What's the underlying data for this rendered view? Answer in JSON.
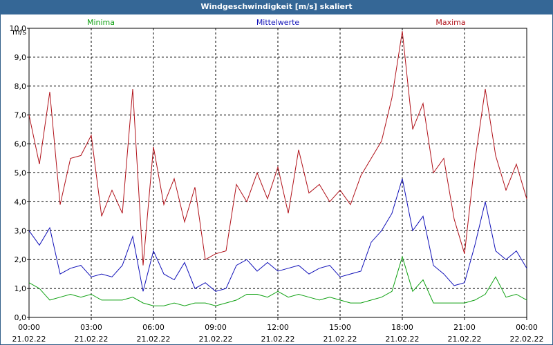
{
  "window": {
    "title": "Windgeschwindigkeit [m/s] skaliert"
  },
  "colors": {
    "minima": "#0da010",
    "mean": "#1010b8",
    "maxima": "#b01018",
    "titlebar": "#356796"
  },
  "chart_data": {
    "type": "line",
    "ylabel": "m/s",
    "ylim": [
      0,
      10
    ],
    "yticks": [
      "0,0",
      "1,0",
      "2,0",
      "3,0",
      "4,0",
      "5,0",
      "6,0",
      "7,0",
      "8,0",
      "9,0",
      "10,0"
    ],
    "xlim_hours": [
      0,
      24
    ],
    "xticks": [
      {
        "time": "00:00",
        "date": "21.02.22"
      },
      {
        "time": "03:00",
        "date": "21.02.22"
      },
      {
        "time": "06:00",
        "date": "21.02.22"
      },
      {
        "time": "09:00",
        "date": "21.02.22"
      },
      {
        "time": "12:00",
        "date": "21.02.22"
      },
      {
        "time": "15:00",
        "date": "21.02.22"
      },
      {
        "time": "18:00",
        "date": "21.02.22"
      },
      {
        "time": "21:00",
        "date": "21.02.22"
      },
      {
        "time": "00:00",
        "date": "22.02.22"
      }
    ],
    "grid": true,
    "legend": [
      "Minima",
      "Mittelwerte",
      "Maxima"
    ],
    "series": [
      {
        "name": "Minima",
        "x": [
          0,
          0.5,
          1,
          1.5,
          2,
          2.5,
          3,
          3.5,
          4,
          4.5,
          5,
          5.5,
          6,
          6.5,
          7,
          7.5,
          8,
          8.5,
          9,
          9.5,
          10,
          10.5,
          11,
          11.5,
          12,
          12.5,
          13,
          13.5,
          14,
          14.5,
          15,
          15.5,
          16,
          16.5,
          17,
          17.5,
          18,
          18.5,
          19,
          19.5,
          20,
          20.5,
          21,
          21.5,
          22,
          22.5,
          23,
          23.5,
          24
        ],
        "values": [
          1.2,
          1.0,
          0.6,
          0.7,
          0.8,
          0.7,
          0.8,
          0.6,
          0.6,
          0.6,
          0.7,
          0.5,
          0.4,
          0.4,
          0.5,
          0.4,
          0.5,
          0.5,
          0.4,
          0.5,
          0.6,
          0.8,
          0.8,
          0.7,
          0.9,
          0.7,
          0.8,
          0.7,
          0.6,
          0.7,
          0.6,
          0.5,
          0.5,
          0.6,
          0.7,
          0.9,
          2.1,
          0.9,
          1.3,
          0.5,
          0.5,
          0.5,
          0.5,
          0.6,
          0.8,
          1.4,
          0.7,
          0.8,
          0.6
        ]
      },
      {
        "name": "Mittelwerte",
        "x": [
          0,
          0.5,
          1,
          1.5,
          2,
          2.5,
          3,
          3.5,
          4,
          4.5,
          5,
          5.5,
          6,
          6.5,
          7,
          7.5,
          8,
          8.5,
          9,
          9.5,
          10,
          10.5,
          11,
          11.5,
          12,
          12.5,
          13,
          13.5,
          14,
          14.5,
          15,
          15.5,
          16,
          16.5,
          17,
          17.5,
          18,
          18.5,
          19,
          19.5,
          20,
          20.5,
          21,
          21.5,
          22,
          22.5,
          23,
          23.5,
          24
        ],
        "values": [
          3.0,
          2.5,
          3.1,
          1.5,
          1.7,
          1.8,
          1.4,
          1.5,
          1.4,
          1.8,
          2.8,
          0.9,
          2.3,
          1.5,
          1.3,
          1.9,
          1.0,
          1.2,
          0.9,
          1.0,
          1.8,
          2.0,
          1.6,
          1.9,
          1.6,
          1.7,
          1.8,
          1.5,
          1.7,
          1.8,
          1.4,
          1.5,
          1.6,
          2.6,
          3.0,
          3.6,
          4.8,
          3.0,
          3.5,
          1.8,
          1.5,
          1.1,
          1.2,
          2.5,
          4.0,
          2.3,
          2.0,
          2.3,
          1.7
        ]
      },
      {
        "name": "Maxima",
        "x": [
          0,
          0.5,
          1,
          1.5,
          2,
          2.5,
          3,
          3.5,
          4,
          4.5,
          5,
          5.5,
          6,
          6.5,
          7,
          7.5,
          8,
          8.5,
          9,
          9.5,
          10,
          10.5,
          11,
          11.5,
          12,
          12.5,
          13,
          13.5,
          14,
          14.5,
          15,
          15.5,
          16,
          16.5,
          17,
          17.5,
          18,
          18.5,
          19,
          19.5,
          20,
          20.5,
          21,
          21.5,
          22,
          22.5,
          23,
          23.5,
          24
        ],
        "values": [
          7.0,
          5.3,
          7.8,
          3.9,
          5.5,
          5.6,
          6.3,
          3.5,
          4.4,
          3.6,
          7.9,
          1.8,
          5.9,
          3.9,
          4.8,
          3.3,
          4.5,
          2.0,
          2.2,
          2.3,
          4.6,
          4.0,
          5.0,
          4.1,
          5.2,
          3.6,
          5.8,
          4.3,
          4.6,
          4.0,
          4.4,
          3.9,
          4.9,
          5.5,
          6.1,
          7.6,
          9.9,
          6.5,
          7.4,
          5.0,
          5.5,
          3.4,
          2.2,
          5.4,
          7.9,
          5.6,
          4.4,
          5.3,
          4.1
        ]
      }
    ]
  }
}
